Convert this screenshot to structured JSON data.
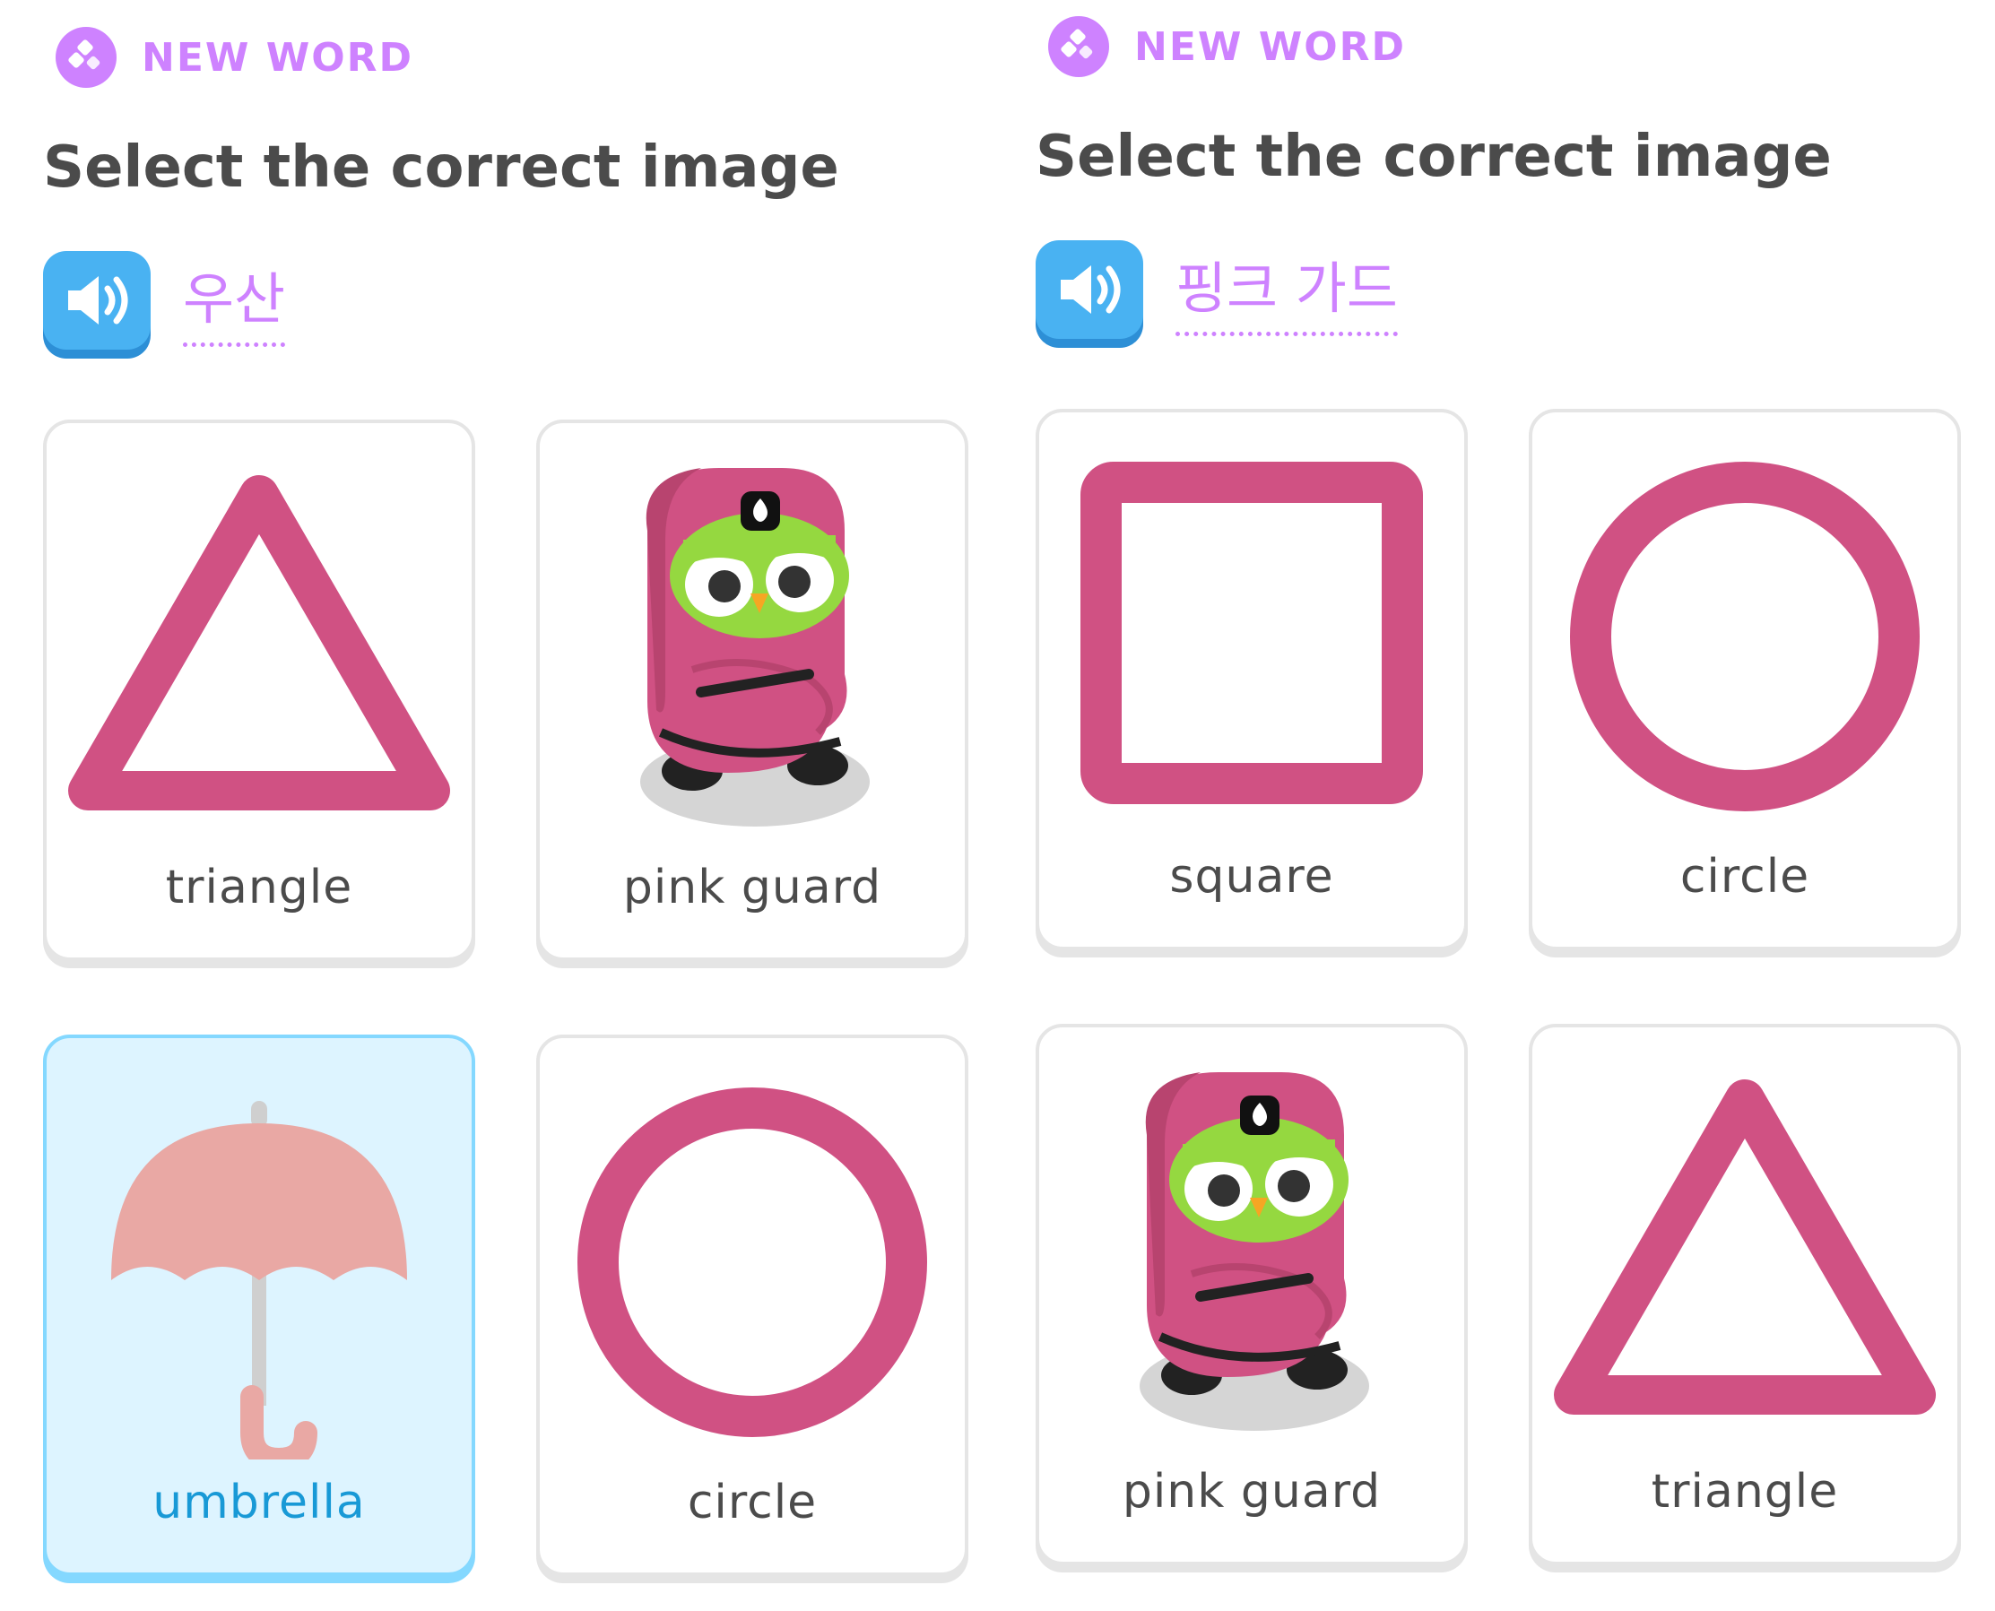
{
  "exercises": [
    {
      "badge": "NEW WORD",
      "instruction": "Select the correct image",
      "word": "우산",
      "options": [
        {
          "label": "triangle",
          "icon": "triangle-icon",
          "selected": false
        },
        {
          "label": "pink guard",
          "icon": "pink-guard-owl-icon",
          "selected": false
        },
        {
          "label": "umbrella",
          "icon": "umbrella-icon",
          "selected": true
        },
        {
          "label": "circle",
          "icon": "circle-icon",
          "selected": false
        }
      ]
    },
    {
      "badge": "NEW WORD",
      "instruction": "Select the correct image",
      "word": "핑크 가드",
      "options": [
        {
          "label": "square",
          "icon": "square-icon",
          "selected": false
        },
        {
          "label": "circle",
          "icon": "circle-icon",
          "selected": false
        },
        {
          "label": "pink guard",
          "icon": "pink-guard-owl-icon",
          "selected": false
        },
        {
          "label": "triangle",
          "icon": "triangle-icon",
          "selected": false
        }
      ]
    }
  ],
  "colors": {
    "accent": "#ce82ff",
    "shape_pink": "#d05183",
    "audio_blue": "#49b2f2",
    "selected_bg": "#ddf4ff",
    "selected_border": "#84d8ff"
  }
}
